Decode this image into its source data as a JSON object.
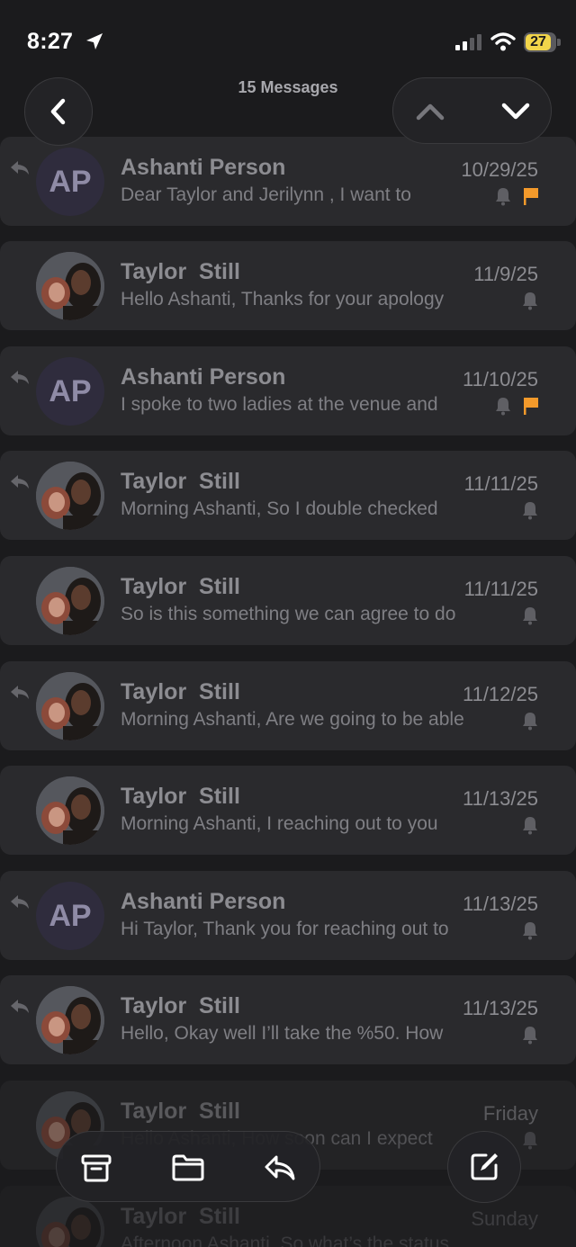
{
  "status_bar": {
    "time": "8:27",
    "battery_level": "27",
    "icons": [
      "location-arrow-icon",
      "cellular-signal-icon",
      "wifi-icon",
      "battery-icon"
    ]
  },
  "header": {
    "title": "15 Messages",
    "back_icon": "chevron-left-icon",
    "prev_icon": "chevron-up-icon",
    "next_icon": "chevron-down-icon"
  },
  "colors": {
    "flag": "#f39a2b",
    "battery": "#f2d54a",
    "row_bg": "#2a2a2d",
    "background": "#1b1b1d"
  },
  "messages": [
    {
      "sender": "Ashanti Person",
      "date": "10/29/25",
      "preview": "Dear Taylor and Jerilynn , I want to",
      "avatar": "AP",
      "replied": true,
      "flagged": true
    },
    {
      "sender": "Taylor  Still",
      "date": "11/9/25",
      "preview": "Hello Ashanti, Thanks for your apology",
      "avatar": "photo",
      "replied": false,
      "flagged": false
    },
    {
      "sender": "Ashanti Person",
      "date": "11/10/25",
      "preview": "I spoke to two ladies at the venue and",
      "avatar": "AP",
      "replied": true,
      "flagged": true
    },
    {
      "sender": "Taylor  Still",
      "date": "11/11/25",
      "preview": "Morning Ashanti, So I double checked",
      "avatar": "photo",
      "replied": true,
      "flagged": false
    },
    {
      "sender": "Taylor  Still",
      "date": "11/11/25",
      "preview": "So is this something we can agree to do",
      "avatar": "photo",
      "replied": false,
      "flagged": false
    },
    {
      "sender": "Taylor  Still",
      "date": "11/12/25",
      "preview": "Morning Ashanti, Are we going to be able",
      "avatar": "photo",
      "replied": true,
      "flagged": false
    },
    {
      "sender": "Taylor  Still",
      "date": "11/13/25",
      "preview": "Morning Ashanti, I reaching out to you",
      "avatar": "photo",
      "replied": false,
      "flagged": false
    },
    {
      "sender": "Ashanti Person",
      "date": "11/13/25",
      "preview": "Hi Taylor, Thank you for reaching out to",
      "avatar": "AP",
      "replied": true,
      "flagged": false
    },
    {
      "sender": "Taylor  Still",
      "date": "11/13/25",
      "preview": "Hello, Okay well I’ll take the %50. How",
      "avatar": "photo",
      "replied": true,
      "flagged": false
    },
    {
      "sender": "Taylor  Still",
      "date": "Friday",
      "preview": "Hello Ashanti, How soon can I expect",
      "avatar": "photo",
      "replied": false,
      "flagged": false
    },
    {
      "sender": "Taylor  Still",
      "date": "Sunday",
      "preview": "Afternoon Ashanti, So what’s the status",
      "avatar": "photo",
      "replied": false,
      "flagged": false
    }
  ],
  "toolbar": {
    "archive_icon": "archive-icon",
    "move_icon": "folder-icon",
    "reply_icon": "reply-icon",
    "compose_icon": "compose-icon"
  }
}
